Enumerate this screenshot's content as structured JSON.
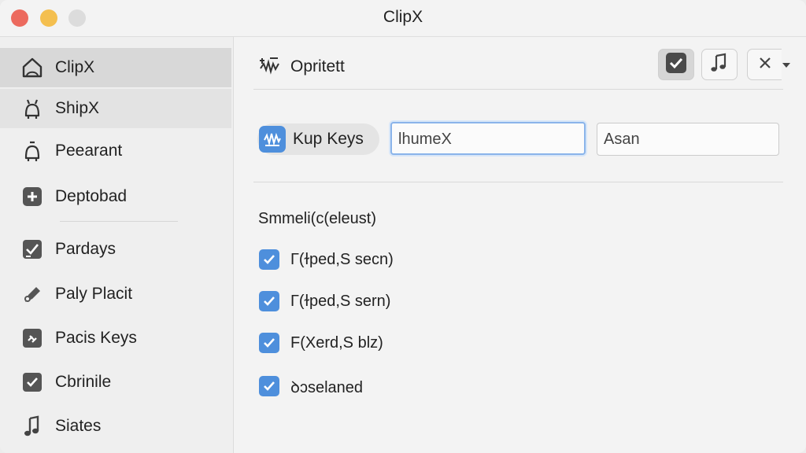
{
  "window": {
    "title": "ClipX"
  },
  "sidebar": {
    "items": [
      {
        "label": "ClipX",
        "icon": "home-icon",
        "state": "selected"
      },
      {
        "label": "ShipX",
        "icon": "bell-icon",
        "state": "hover"
      },
      {
        "label": "Peearant",
        "icon": "bell-icon",
        "state": ""
      },
      {
        "label": "Deptobad",
        "icon": "plus-square-icon",
        "state": ""
      },
      {
        "label": "Pardays",
        "icon": "checklist-icon",
        "state": ""
      },
      {
        "label": "Paly Placit",
        "icon": "pen-icon",
        "state": ""
      },
      {
        "label": "Pacis Keys",
        "icon": "tag-icon",
        "state": ""
      },
      {
        "label": "Cbrinile",
        "icon": "check-square-icon",
        "state": ""
      },
      {
        "label": "Siates",
        "icon": "music-note-icon",
        "state": ""
      }
    ]
  },
  "main": {
    "header": {
      "title": "Opritett",
      "icon": "waveform-icon"
    },
    "toolbar": {
      "buttons": [
        {
          "icon": "checkmark-icon",
          "active": true
        },
        {
          "icon": "music-note-icon",
          "active": false
        },
        {
          "icon": "close-icon",
          "active": false,
          "has_dropdown": true
        }
      ]
    },
    "shortcut": {
      "label": "Kup Keys",
      "icon": "waveform-icon",
      "field1_value": "lhumeX",
      "field2_value": "Asan"
    },
    "options": {
      "title": "Smmeli(c(eleust)",
      "checkboxes": [
        {
          "label": "Г(ɫped,S secn)",
          "checked": true
        },
        {
          "label": "Г(ɫped,S sern)",
          "checked": true
        },
        {
          "label": "F(Xerd,S blz)",
          "checked": true
        },
        {
          "label": "ꝺɔselaned",
          "checked": true
        }
      ]
    }
  },
  "colors": {
    "accent": "#4e8fdc",
    "close": "#ec6a5e",
    "minimize": "#f4bf4f",
    "maximize": "#dcdcdc"
  }
}
